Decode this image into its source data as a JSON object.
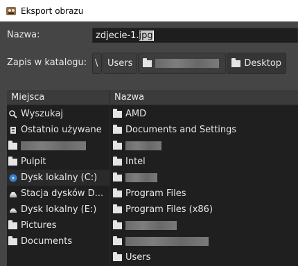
{
  "window": {
    "title": "Eksport obrazu"
  },
  "form": {
    "name_label": "Nazwa:",
    "filename_base": "zdjecie-1.",
    "filename_ext_selected": "jpg",
    "save_in_label": "Zapis w katalogu:"
  },
  "breadcrumbs": [
    {
      "label": "\\"
    },
    {
      "label": "Users"
    },
    {
      "label": ""
    },
    {
      "label": "Desktop"
    }
  ],
  "places": {
    "header": "Miejsca",
    "items": [
      {
        "label": "Wyszukaj",
        "icon": "search-icon"
      },
      {
        "label": "Ostatnio używane",
        "icon": "recent-icon"
      },
      {
        "label": "",
        "icon": "folder-icon"
      },
      {
        "label": "Pulpit",
        "icon": "folder-icon"
      },
      {
        "label": "Dysk lokalny (C:)",
        "icon": "disk-icon"
      },
      {
        "label": "Stacja dysków D...",
        "icon": "drive-icon"
      },
      {
        "label": "Dysk lokalny (E:)",
        "icon": "drive-icon"
      },
      {
        "label": "Pictures",
        "icon": "folder-icon"
      },
      {
        "label": "Documents",
        "icon": "folder-icon"
      }
    ]
  },
  "files": {
    "header": "Nazwa",
    "items": [
      {
        "label": "AMD"
      },
      {
        "label": "Documents and Settings"
      },
      {
        "label": ""
      },
      {
        "label": "Intel"
      },
      {
        "label": ""
      },
      {
        "label": "Program Files"
      },
      {
        "label": "Program Files (x86)"
      },
      {
        "label": ""
      },
      {
        "label": ""
      },
      {
        "label": "Users"
      }
    ]
  }
}
